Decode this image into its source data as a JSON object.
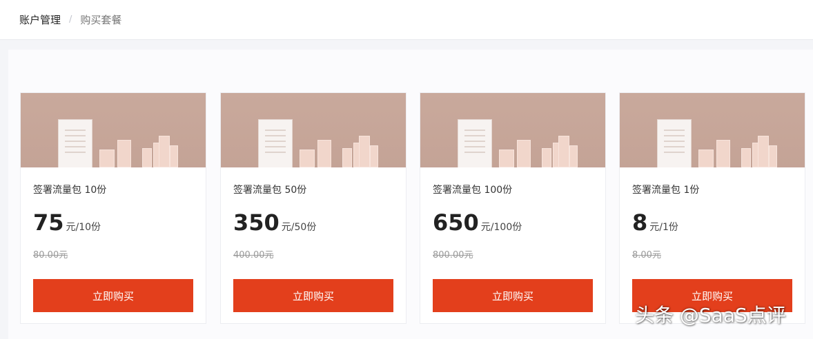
{
  "breadcrumb": {
    "home": "账户管理",
    "separator": "/",
    "current": "购买套餐"
  },
  "packages": [
    {
      "title": "签署流量包 10份",
      "price": "75",
      "unit": "元/10份",
      "original_price": "80.00元",
      "button_label": "立即购买"
    },
    {
      "title": "签署流量包 50份",
      "price": "350",
      "unit": "元/50份",
      "original_price": "400.00元",
      "button_label": "立即购买"
    },
    {
      "title": "签署流量包 100份",
      "price": "650",
      "unit": "元/100份",
      "original_price": "800.00元",
      "button_label": "立即购买"
    },
    {
      "title": "签署流量包 1份",
      "price": "8",
      "unit": "元/1份",
      "original_price": "8.00元",
      "button_label": "立即购买"
    }
  ],
  "watermark": "头条 @SaaS点评",
  "colors": {
    "accent": "#e33f1c",
    "banner": "#c7a699",
    "page_bg": "#f4f5f8"
  },
  "icons": [
    "document-illustration",
    "bar-chart-illustration"
  ]
}
